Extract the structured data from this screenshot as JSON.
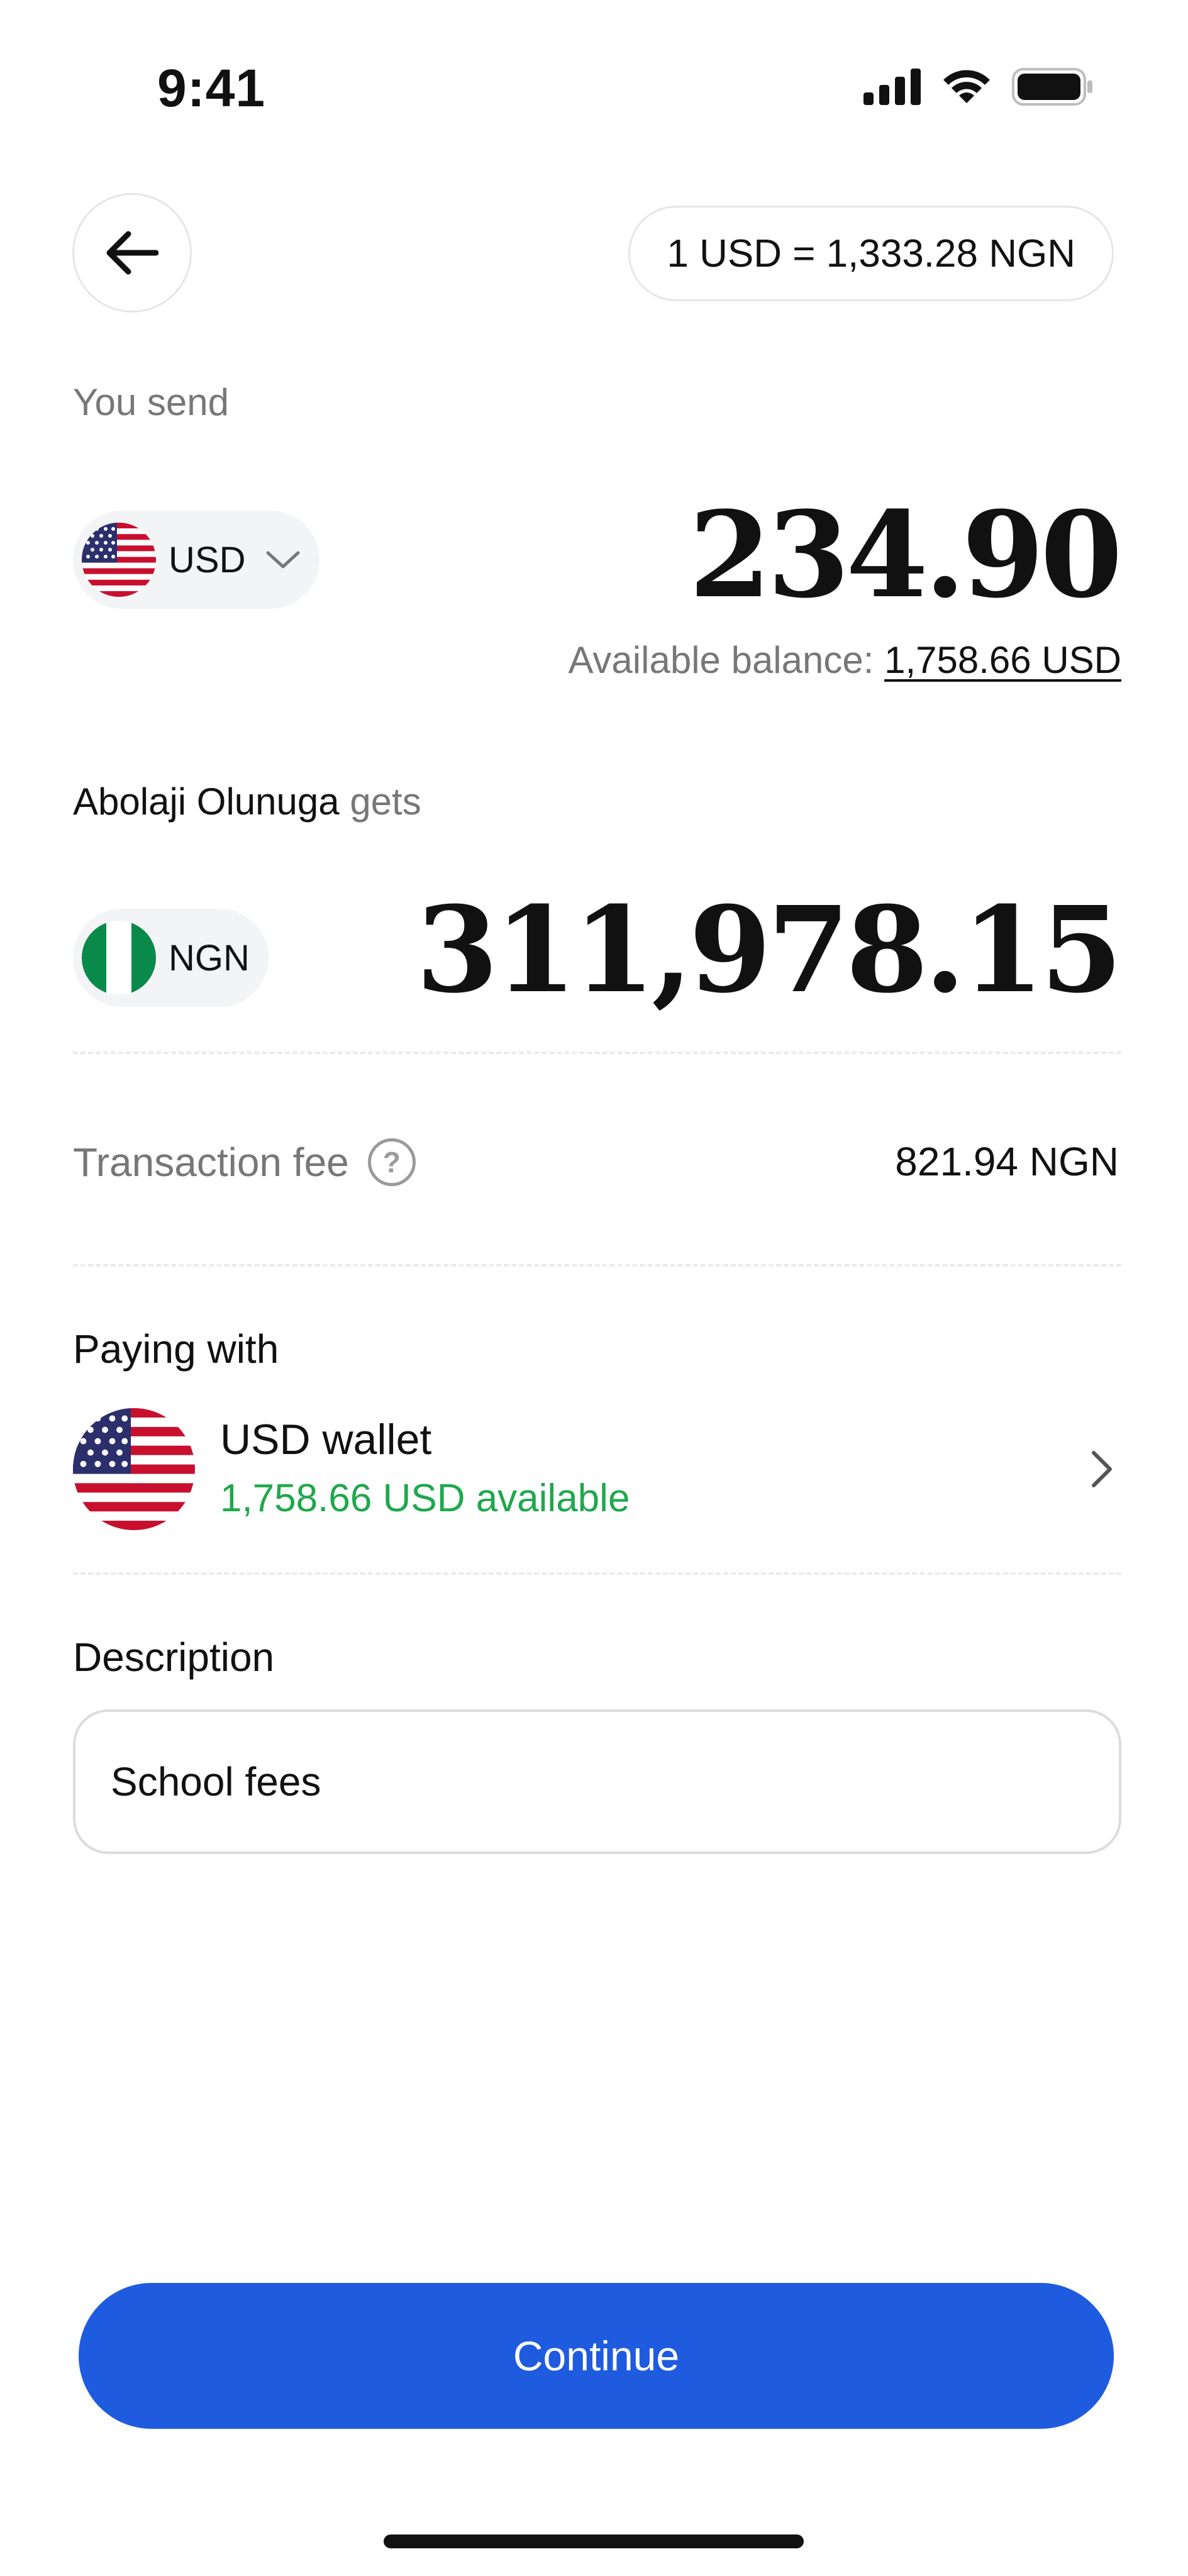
{
  "status_bar": {
    "time": "9:41",
    "icons": [
      "signal-icon",
      "wifi-icon",
      "battery-icon"
    ]
  },
  "header": {
    "back_icon": "arrow-left-icon",
    "exchange_rate": "1 USD = 1,333.28 NGN"
  },
  "send": {
    "label": "You send",
    "currency": "USD",
    "flag": "us-flag-icon",
    "dropdown_icon": "chevron-down-icon",
    "amount": "234.90",
    "balance_label": "Available balance:",
    "balance_value": "1,758.66 USD"
  },
  "receive": {
    "recipient_name": "Abolaji Olunuga",
    "gets_label": "gets",
    "currency": "NGN",
    "flag": "ng-flag-icon",
    "amount": "311,978.15"
  },
  "fee": {
    "label": "Transaction fee",
    "help_icon": "question-icon",
    "value": "821.94 NGN"
  },
  "paying": {
    "label": "Paying with",
    "wallet_name": "USD wallet",
    "wallet_available": "1,758.66 USD available",
    "chevron_icon": "chevron-right-icon"
  },
  "description": {
    "label": "Description",
    "value": "School fees"
  },
  "actions": {
    "continue_label": "Continue"
  },
  "colors": {
    "primary": "#1f5bdf",
    "success": "#1fa84c",
    "muted": "#777777",
    "pill_bg": "#f3f4f6"
  }
}
